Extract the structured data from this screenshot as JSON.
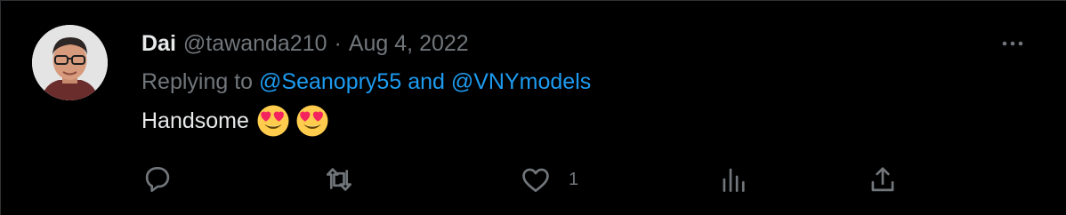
{
  "tweet": {
    "display_name": "Dai",
    "handle": "@tawanda210",
    "separator": "·",
    "date": "Aug 4, 2022",
    "replying_prefix": "Replying to",
    "mention_1": "@Seanopry55",
    "mention_joiner": "and",
    "mention_2": "@VNYmodels",
    "text": "Handsome",
    "emojis": [
      "smiling-face-with-heart-eyes",
      "smiling-face-with-heart-eyes"
    ]
  },
  "actions": {
    "reply_count": "",
    "retweet_count": "",
    "like_count": "1",
    "analytics_count": ""
  },
  "colors": {
    "background": "#000000",
    "primary_text": "#e7e9ea",
    "secondary_text": "#71767b",
    "accent": "#1d9bf0"
  }
}
